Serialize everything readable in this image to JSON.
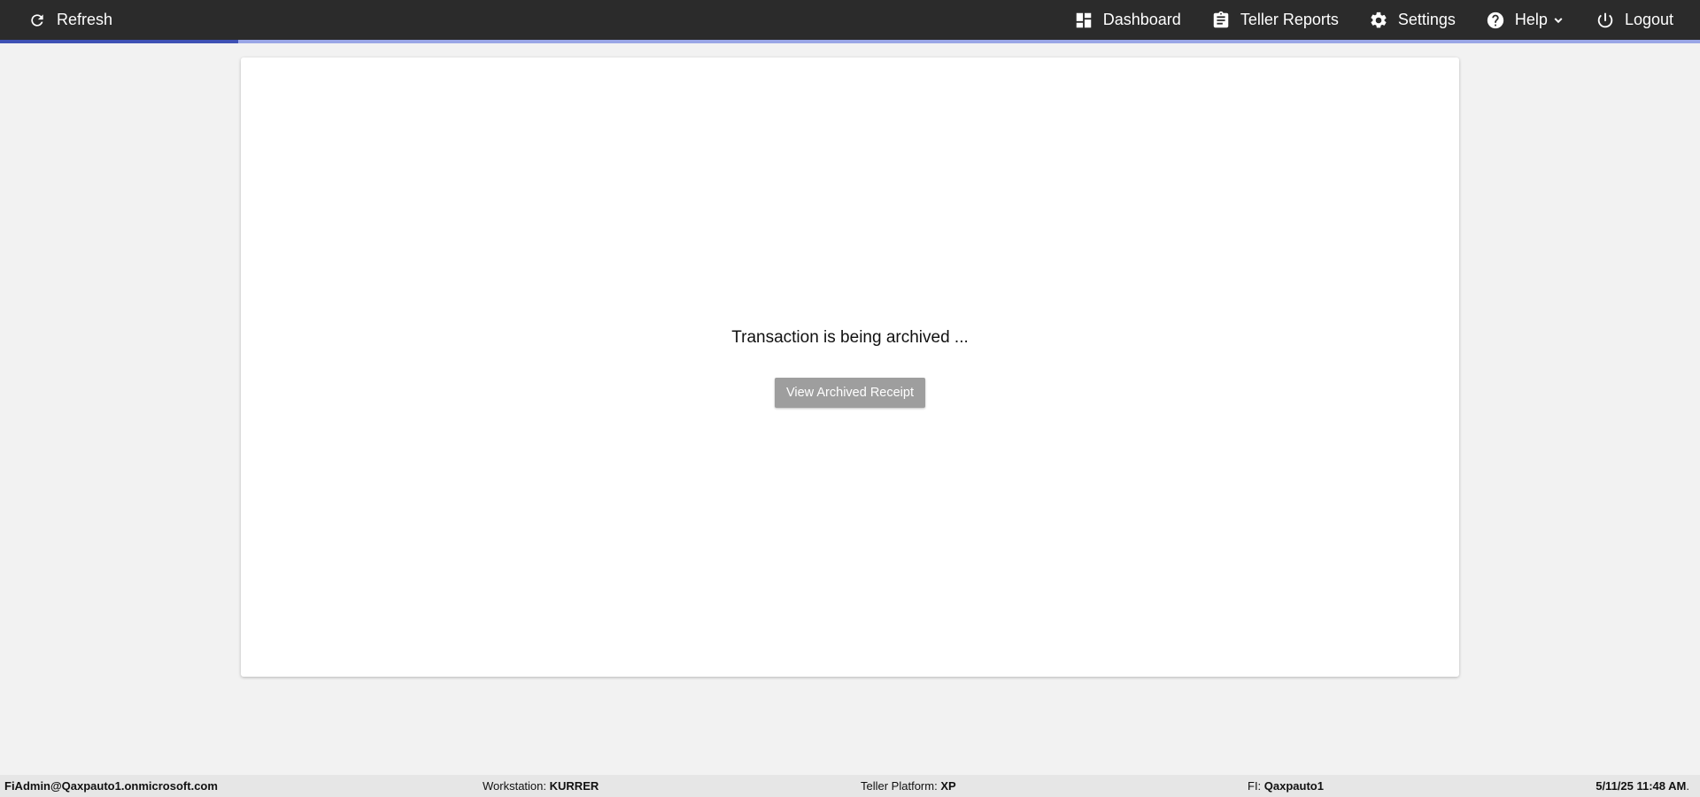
{
  "topbar": {
    "refresh_label": "Refresh",
    "nav": [
      {
        "label": "Dashboard",
        "icon": "dashboard-icon"
      },
      {
        "label": "Teller Reports",
        "icon": "clipboard-icon"
      },
      {
        "label": "Settings",
        "icon": "gear-icon"
      },
      {
        "label": "Help",
        "icon": "help-circle-icon"
      },
      {
        "label": "Logout",
        "icon": "power-icon"
      }
    ]
  },
  "progress": {
    "fraction": 0.14
  },
  "main": {
    "status_message": "Transaction is being archived ...",
    "view_receipt_label": "View Archived Receipt"
  },
  "statusbar": {
    "user": "FiAdmin@Qaxpauto1.onmicrosoft.com",
    "workstation_label": "Workstation:",
    "workstation_value": "KURRER",
    "platform_label": "Teller Platform:",
    "platform_value": "XP",
    "fi_label": "FI:",
    "fi_value": "Qaxpauto1",
    "datetime": "5/11/25 11:48 AM"
  },
  "colors": {
    "topbar_bg": "#2b2b2b",
    "progress_fill": "#3f51b5",
    "progress_track": "#9aa6e6",
    "button_disabled": "#9e9e9e"
  }
}
